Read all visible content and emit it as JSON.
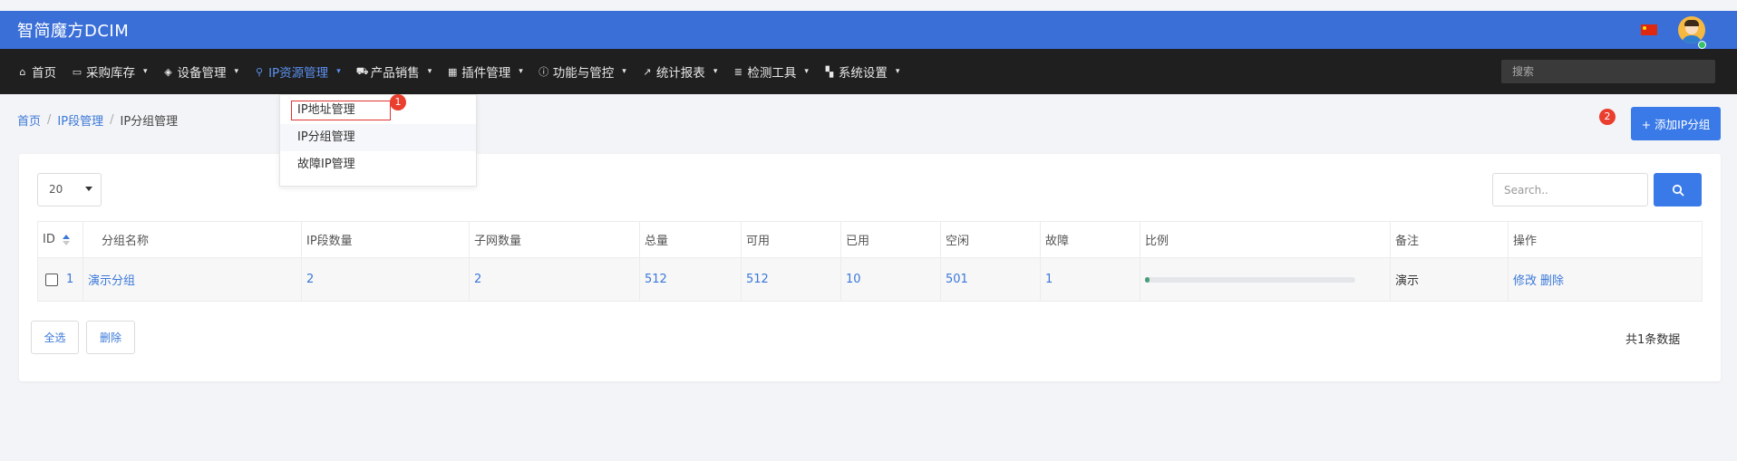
{
  "header": {
    "brand": "智简魔方DCIM"
  },
  "nav": {
    "items": [
      {
        "label": "首页",
        "icon": "home-icon",
        "glyph": "⌂",
        "caret": false,
        "active": false
      },
      {
        "label": "采购库存",
        "icon": "inbox-icon",
        "glyph": "▭",
        "caret": true,
        "active": false
      },
      {
        "label": "设备管理",
        "icon": "cube-icon",
        "glyph": "◈",
        "caret": true,
        "active": false
      },
      {
        "label": "IP资源管理",
        "icon": "map-marker-icon",
        "glyph": "⚲",
        "caret": true,
        "active": true
      },
      {
        "label": "产品销售",
        "icon": "cart-icon",
        "glyph": "⛟",
        "caret": true,
        "active": false
      },
      {
        "label": "插件管理",
        "icon": "grid-icon",
        "glyph": "▦",
        "caret": true,
        "active": false
      },
      {
        "label": "功能与管控",
        "icon": "info-icon",
        "glyph": "ⓘ",
        "caret": true,
        "active": false
      },
      {
        "label": "统计报表",
        "icon": "line-chart-icon",
        "glyph": "↗",
        "caret": true,
        "active": false
      },
      {
        "label": "检测工具",
        "icon": "list-icon",
        "glyph": "≣",
        "caret": true,
        "active": false
      },
      {
        "label": "系统设置",
        "icon": "th-large-icon",
        "glyph": "▚",
        "caret": true,
        "active": false
      }
    ],
    "search_placeholder": "搜索"
  },
  "dropdown": {
    "items": [
      "IP地址管理",
      "IP分组管理",
      "故障IP管理"
    ],
    "badge": "1"
  },
  "breadcrumb": {
    "home": "首页",
    "parent": "IP段管理",
    "current": "IP分组管理",
    "sep": "/"
  },
  "actions": {
    "add_label": "+ 添加IP分组",
    "badge": "2"
  },
  "toolbar": {
    "page_size": "20",
    "search_placeholder": "Search.."
  },
  "table": {
    "columns": [
      "ID",
      "分组名称",
      "IP段数量",
      "子网数量",
      "总量",
      "可用",
      "已用",
      "空闲",
      "故障",
      "比例",
      "备注",
      "操作"
    ],
    "rows": [
      {
        "id": "1",
        "name": "演示分组",
        "segment_count": "2",
        "subnet_count": "2",
        "total": "512",
        "available": "512",
        "used": "10",
        "free": "501",
        "fault": "1",
        "ratio": 0.02,
        "remark": "演示",
        "edit": "修改",
        "delete": "删除"
      }
    ]
  },
  "footer": {
    "select_all": "全选",
    "delete": "删除",
    "total_text": "共1条数据"
  },
  "colors": {
    "header_blue": "#3a6fd8",
    "navbar_dark": "#1f1f1f",
    "link_blue": "#3a78d8",
    "primary_button": "#3a7ae8",
    "badge_red": "#ea3f2f",
    "progress_fill": "#4a9d78"
  }
}
